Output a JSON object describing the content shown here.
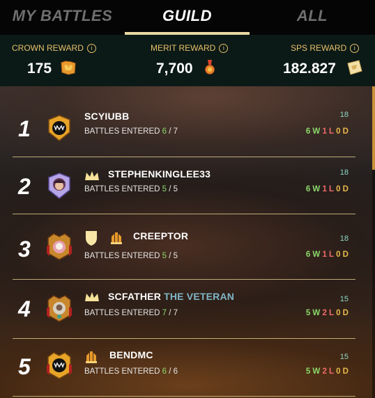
{
  "tabs": [
    {
      "label": "MY BATTLES",
      "active": false
    },
    {
      "label": "GUILD",
      "active": true
    },
    {
      "label": "ALL",
      "active": false
    }
  ],
  "rewards": {
    "crown": {
      "label": "CROWN REWARD",
      "value": "175",
      "icon": "crown-reward-icon"
    },
    "merit": {
      "label": "MERIT REWARD",
      "value": "7,700",
      "icon": "merit-medal-icon"
    },
    "sps": {
      "label": "SPS REWARD",
      "value": "182.827",
      "icon": "sps-token-icon"
    }
  },
  "players": [
    {
      "rank": "1",
      "name": "SCYIUBB",
      "title": "",
      "battles_label": "BATTLES ENTERED",
      "battles_done": "6",
      "battles_total": "7",
      "score": "18",
      "wins": "6 W",
      "losses": "1 L",
      "draws": "0 D",
      "badges": []
    },
    {
      "rank": "2",
      "name": "STEPHENKINGLEE33",
      "title": "",
      "battles_label": "BATTLES ENTERED",
      "battles_done": "5",
      "battles_total": "5",
      "score": "18",
      "wins": "6 W",
      "losses": "1 L",
      "draws": "0 D",
      "badges": [
        "crown"
      ]
    },
    {
      "rank": "3",
      "name": "CREEPTOR",
      "title": "",
      "battles_label": "BATTLES ENTERED",
      "battles_done": "5",
      "battles_total": "5",
      "score": "18",
      "wins": "6 W",
      "losses": "1 L",
      "draws": "0 D",
      "badges": [
        "shield",
        "guild-rank"
      ]
    },
    {
      "rank": "4",
      "name": "SCFATHER",
      "title": "THE VETERAN",
      "battles_label": "BATTLES ENTERED",
      "battles_done": "7",
      "battles_total": "7",
      "score": "15",
      "wins": "5 W",
      "losses": "2 L",
      "draws": "0 D",
      "badges": [
        "crown"
      ]
    },
    {
      "rank": "5",
      "name": "BENDMC",
      "title": "",
      "battles_label": "BATTLES ENTERED",
      "battles_done": "6",
      "battles_total": "6",
      "score": "15",
      "wins": "5 W",
      "losses": "2 L",
      "draws": "0 D",
      "badges": [
        "guild-rank"
      ]
    }
  ],
  "colors": {
    "accent": "#e9d9a3",
    "gold": "#e8c06a",
    "win": "#8cd86a",
    "loss": "#ef6a6a",
    "draw": "#e8b84a",
    "score": "#8dd9c6"
  }
}
